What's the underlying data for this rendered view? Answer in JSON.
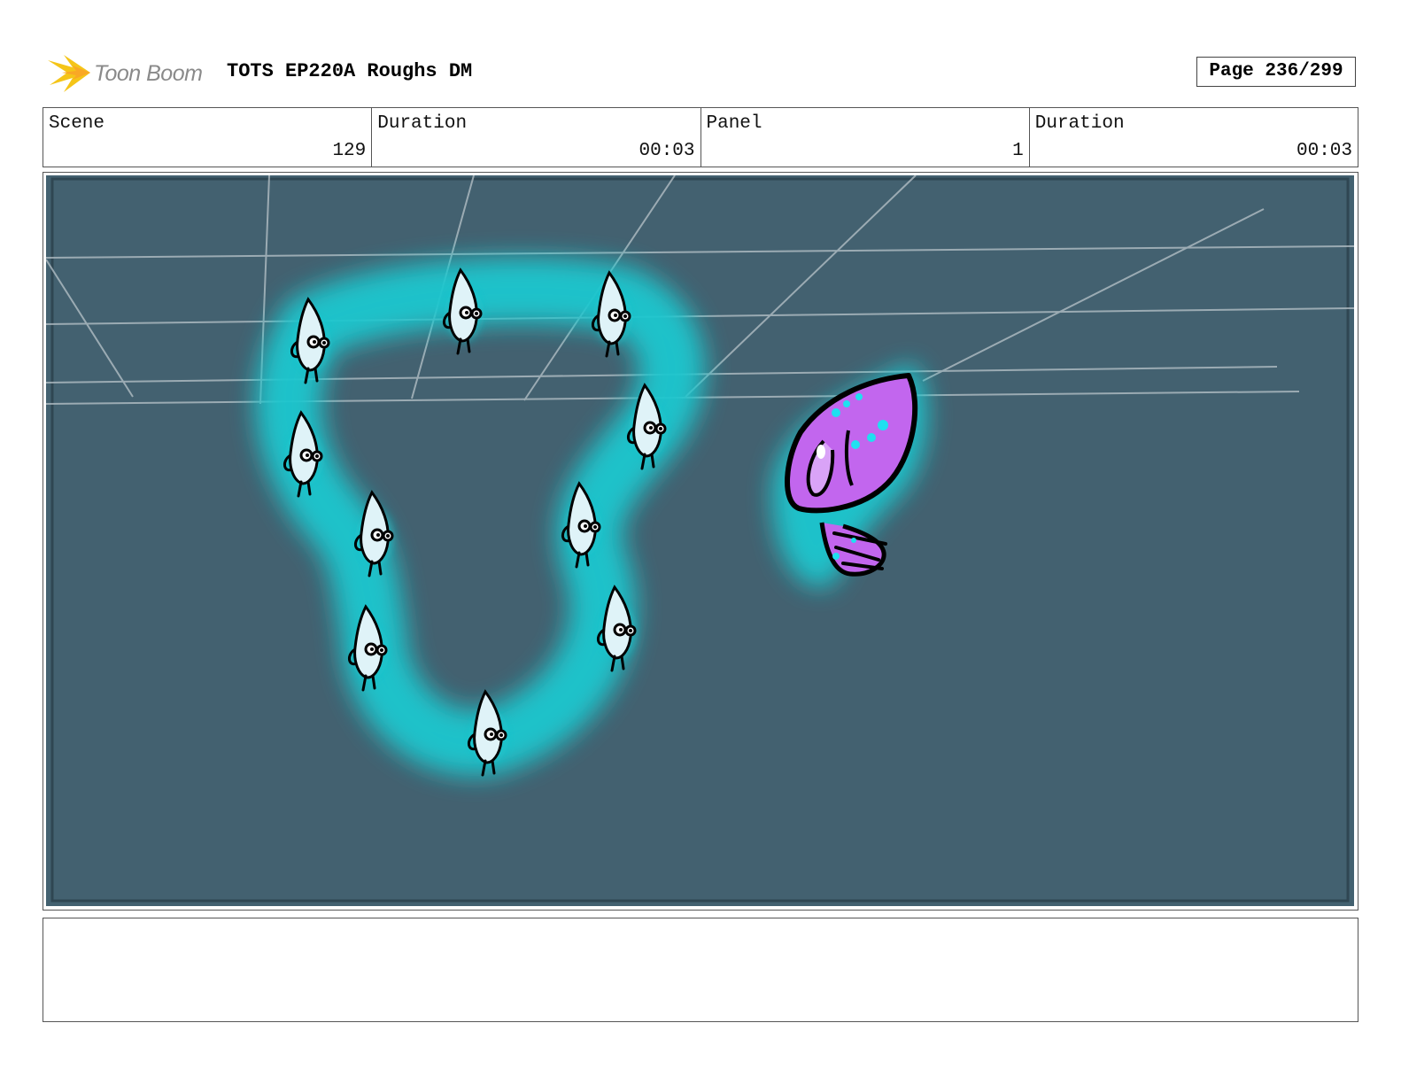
{
  "header": {
    "logo_text": "Toon Boom",
    "title": "TOTS EP220A Roughs DM",
    "page": "Page 236/299"
  },
  "info": {
    "scene_label": "Scene",
    "scene_value": "129",
    "scene_duration_label": "Duration",
    "scene_duration_value": "00:03",
    "panel_label": "Panel",
    "panel_value": "1",
    "panel_duration_label": "Duration",
    "panel_duration_value": "00:03"
  },
  "colors": {
    "panel_bg": "#436170",
    "glow": "#1fc7cf",
    "squid": "#c266ee",
    "logo": "#f5c518"
  },
  "icons": {
    "logo": "toon-boom-burst-icon"
  },
  "notes": ""
}
